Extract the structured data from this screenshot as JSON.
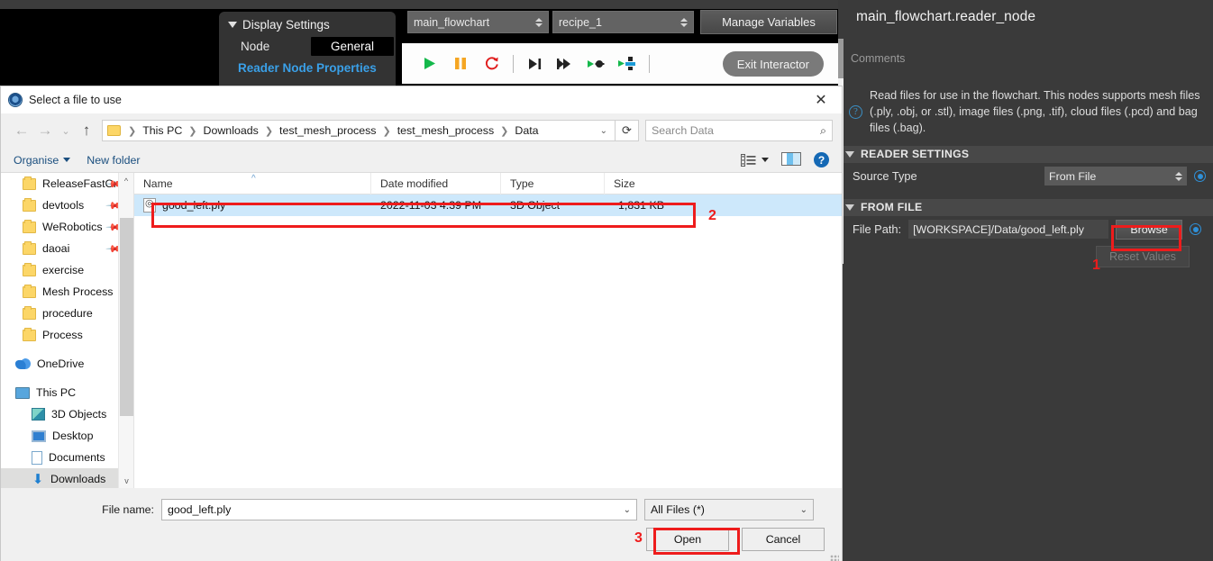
{
  "app": {
    "display_settings": {
      "title": "Display Settings",
      "node_label": "Node",
      "general_tab": "General",
      "link": "Reader Node Properties"
    },
    "flowchart_combo": "main_flowchart",
    "recipe_combo": "recipe_1",
    "manage_variables_button": "Manage Variables",
    "exit_interactor_button": "Exit Interactor",
    "toolbar_icons": [
      "play-icon",
      "pause-icon",
      "reload-icon",
      "step-forward-icon",
      "skip-forward-icon",
      "run-to-node-icon",
      "run-to-breakpoint-icon"
    ]
  },
  "properties": {
    "title": "main_flowchart.reader_node",
    "comments_placeholder": "Comments",
    "description": "Read files for use in the flowchart. This nodes supports mesh files (.ply, .obj, or .stl), image files (.png, .tif), cloud files (.pcd) and bag files (.bag).",
    "reader_settings_header": "READER SETTINGS",
    "source_type_label": "Source Type",
    "source_type_value": "From File",
    "from_file_header": "FROM FILE",
    "file_path_label": "File Path:",
    "file_path_value": "[WORKSPACE]/Data/good_left.ply",
    "browse_button": "Browse",
    "reset_values_button": "Reset Values"
  },
  "dialog": {
    "title": "Select a file to use",
    "close_label": "✕",
    "breadcrumbs": [
      "This PC",
      "Downloads",
      "test_mesh_process",
      "test_mesh_process",
      "Data"
    ],
    "search_placeholder": "Search Data",
    "organise_label": "Organise",
    "new_folder_label": "New folder",
    "nav_items": [
      {
        "label": "ReleaseFastCı",
        "icon": "folder-icon",
        "pinned": true
      },
      {
        "label": "devtools",
        "icon": "folder-icon",
        "pinned": true
      },
      {
        "label": "WeRobotics",
        "icon": "folder-icon",
        "pinned": true
      },
      {
        "label": "daoai",
        "icon": "folder-icon",
        "pinned": true
      },
      {
        "label": "exercise",
        "icon": "folder-icon",
        "pinned": false
      },
      {
        "label": "Mesh Process",
        "icon": "folder-icon",
        "pinned": false
      },
      {
        "label": "procedure",
        "icon": "folder-icon",
        "pinned": false
      },
      {
        "label": "Process",
        "icon": "folder-icon",
        "pinned": false
      },
      {
        "label": "OneDrive",
        "icon": "cloud-icon",
        "pinned": false
      },
      {
        "label": "This PC",
        "icon": "this-pc-icon",
        "pinned": false
      },
      {
        "label": "3D Objects",
        "icon": "cube-icon",
        "pinned": false
      },
      {
        "label": "Desktop",
        "icon": "desktop-icon",
        "pinned": false
      },
      {
        "label": "Documents",
        "icon": "documents-icon",
        "pinned": false
      },
      {
        "label": "Downloads",
        "icon": "downloads-icon",
        "pinned": false
      }
    ],
    "columns": [
      "Name",
      "Date modified",
      "Type",
      "Size"
    ],
    "rows": [
      {
        "name": "good_left.ply",
        "date_modified": "2022-11-03 4:39 PM",
        "type": "3D Object",
        "size": "1,831 KB"
      }
    ],
    "file_name_label": "File name:",
    "file_name_value": "good_left.ply",
    "file_type_value": "All Files  (*)",
    "open_button": "Open",
    "cancel_button": "Cancel"
  },
  "annotations": {
    "step1": "1",
    "step2": "2",
    "step3": "3",
    "color": "#ee1c1c"
  }
}
